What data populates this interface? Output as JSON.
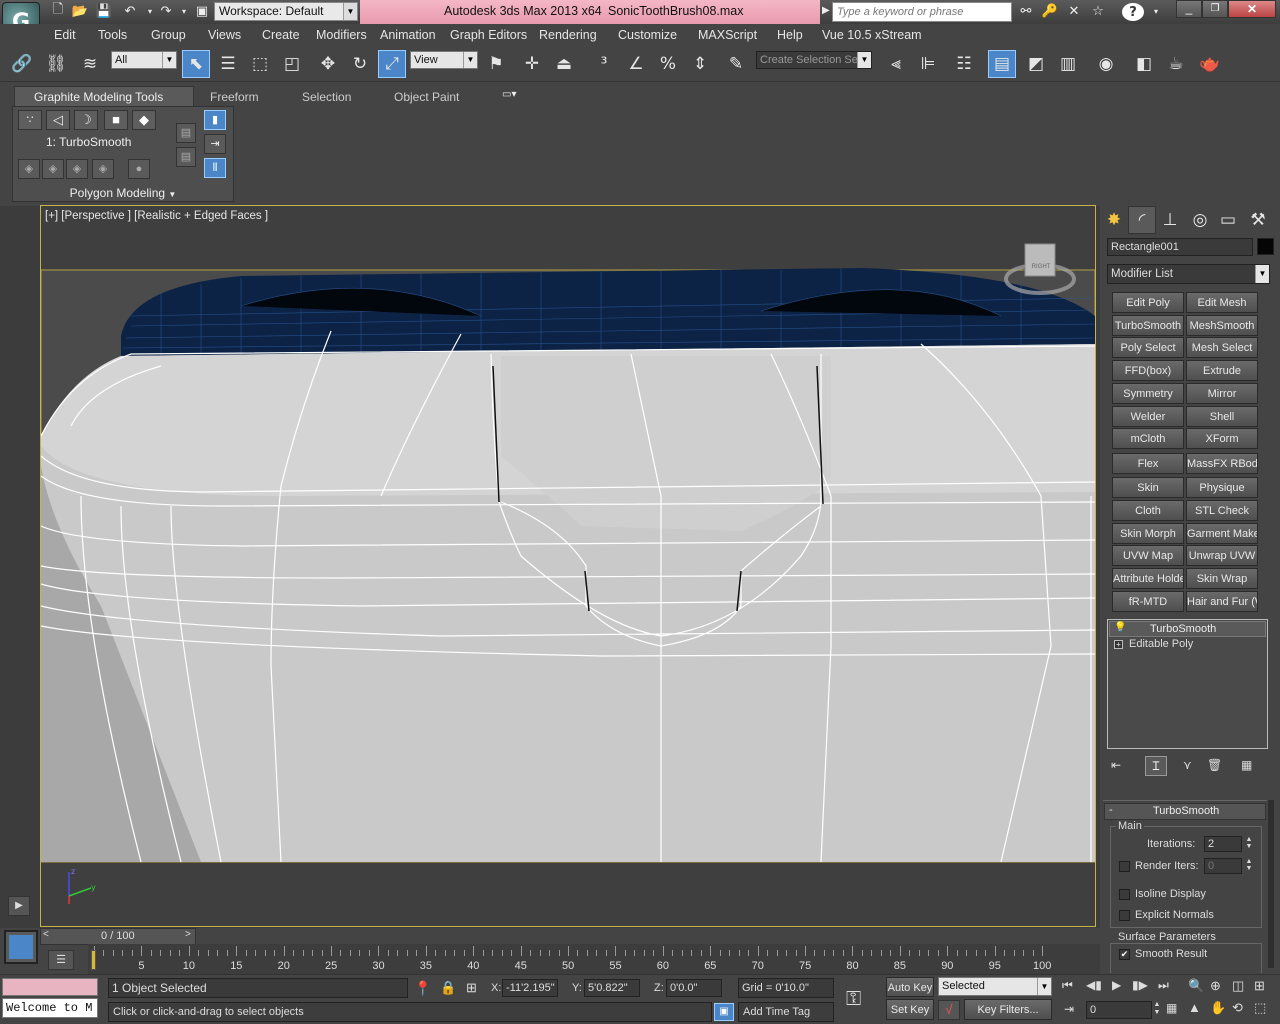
{
  "titlebar": {
    "workspace": "Workspace: Default",
    "app_title": "Autodesk 3ds Max  2013 x64",
    "file_name": "SonicToothBrush08.max",
    "search_placeholder": "Type a keyword or phrase"
  },
  "menu": [
    "Edit",
    "Tools",
    "Group",
    "Views",
    "Create",
    "Modifiers",
    "Animation",
    "Graph Editors",
    "Rendering",
    "Customize",
    "MAXScript",
    "Help",
    "Vue 10.5 xStream"
  ],
  "toolbar": {
    "selection_filter": "All",
    "ref_coord": "View",
    "named_selection": "Create Selection Se"
  },
  "ribbon": {
    "tabs": [
      "Graphite Modeling Tools",
      "Freeform",
      "Selection",
      "Object Paint"
    ],
    "modifier_label": "1: TurboSmooth",
    "panel_label": "Polygon Modeling"
  },
  "viewport": {
    "label": "[+] [Perspective ] [Realistic + Edged Faces ]",
    "viewcube_label": "RIGHT"
  },
  "command_panel": {
    "object_name": "Rectangle001",
    "modifier_list": "Modifier List",
    "modifier_buttons": [
      [
        "Edit Poly",
        "Edit Mesh"
      ],
      [
        "TurboSmooth",
        "MeshSmooth"
      ],
      [
        "Poly Select",
        "Mesh Select"
      ],
      [
        "FFD(box)",
        "Extrude"
      ],
      [
        "Symmetry",
        "Mirror"
      ],
      [
        "Welder",
        "Shell"
      ],
      [
        "mCloth",
        "XForm"
      ],
      [
        "Flex",
        "MassFX RBody"
      ],
      [
        "Skin",
        "Physique"
      ],
      [
        "Cloth",
        "STL Check"
      ],
      [
        "Skin Morph",
        "Garment Maker"
      ],
      [
        "UVW Map",
        "Unwrap UVW"
      ],
      [
        "Attribute Holder",
        "Skin Wrap"
      ],
      [
        "fR-MTD",
        "Hair and Fur (WSM)"
      ]
    ],
    "stack": [
      "TurboSmooth",
      "Editable Poly"
    ],
    "rollout": {
      "title": "TurboSmooth",
      "main_group": "Main",
      "iterations_label": "Iterations:",
      "iterations_value": "2",
      "render_iters_label": "Render Iters:",
      "render_iters_value": "0",
      "isoline_label": "Isoline Display",
      "explicit_normals_label": "Explicit Normals",
      "surface_group": "Surface Parameters",
      "smooth_result_label": "Smooth Result",
      "render_iters_checked": false,
      "isoline_checked": false,
      "explicit_normals_checked": false,
      "smooth_result_checked": true
    }
  },
  "timeline": {
    "frame_counter": "0 / 100",
    "ticks": [
      "5",
      "10",
      "15",
      "20",
      "25",
      "30",
      "35",
      "40",
      "45",
      "50",
      "55",
      "60",
      "65",
      "70",
      "75",
      "80",
      "85",
      "90",
      "95",
      "100"
    ]
  },
  "status": {
    "maxscript_listener": "Welcome to M",
    "selection": "1 Object Selected",
    "prompt": "Click or click-and-drag to select objects",
    "x_label": "X:",
    "x_value": "-11'2.195\"",
    "y_label": "Y:",
    "y_value": "5'0.822\"",
    "z_label": "Z:",
    "z_value": "0'0.0\"",
    "grid": "Grid = 0'10.0\"",
    "add_time_tag": "Add Time Tag",
    "auto_key": "Auto Key",
    "set_key": "Set Key",
    "key_mode": "Selected",
    "key_filters": "Key Filters...",
    "current_frame": "0"
  }
}
